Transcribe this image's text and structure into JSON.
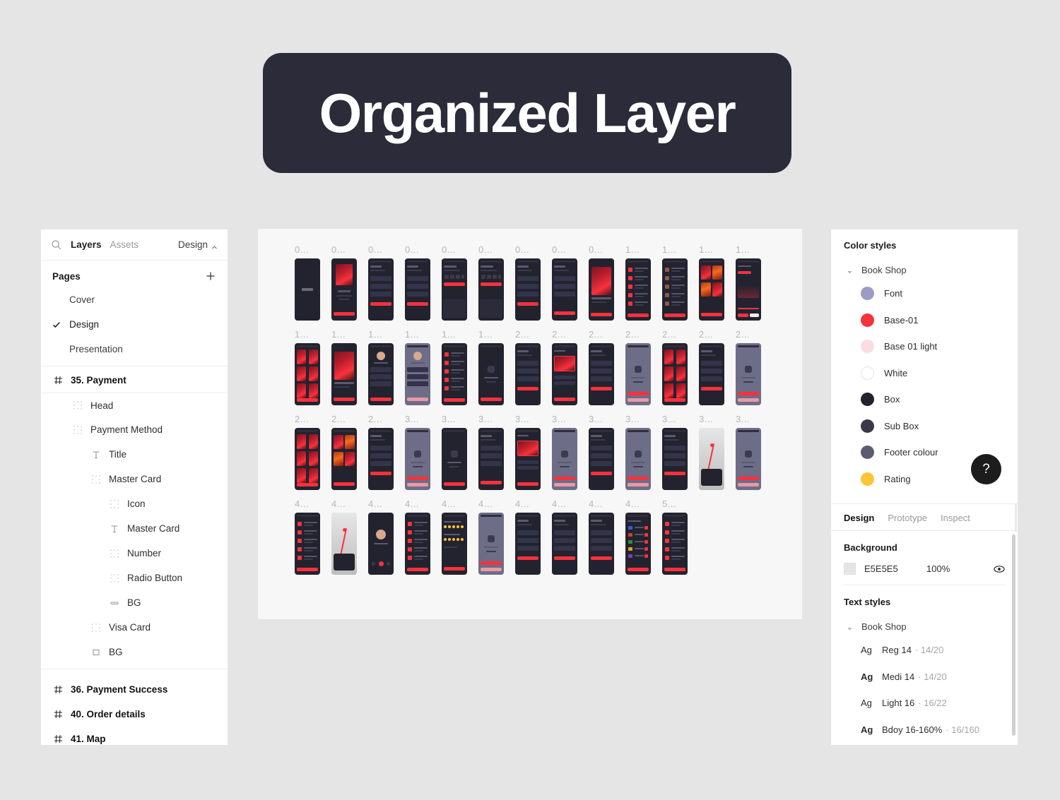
{
  "banner": {
    "title": "Organized Layer"
  },
  "left_panel": {
    "tabs": {
      "layers": "Layers",
      "assets": "Assets",
      "right_mode": "Design"
    },
    "pages": {
      "header": "Pages",
      "items": [
        {
          "label": "Cover",
          "selected": false
        },
        {
          "label": "Design",
          "selected": true
        },
        {
          "label": "Presentation",
          "selected": false
        }
      ]
    },
    "layers": [
      {
        "label": "35. Payment",
        "icon": "frame-icon",
        "depth": 0,
        "type": "frame"
      },
      {
        "label": "Head",
        "icon": "component-icon",
        "depth": 1,
        "type": "group"
      },
      {
        "label": "Payment Method",
        "icon": "component-icon",
        "depth": 1,
        "type": "group"
      },
      {
        "label": "Title",
        "icon": "text-icon",
        "depth": 2,
        "type": "text"
      },
      {
        "label": "Master Card",
        "icon": "component-icon",
        "depth": 2,
        "type": "group"
      },
      {
        "label": "Icon",
        "icon": "component-icon",
        "depth": 3,
        "type": "group"
      },
      {
        "label": "Master Card",
        "icon": "text-icon",
        "depth": 3,
        "type": "text"
      },
      {
        "label": "Number",
        "icon": "component-icon",
        "depth": 3,
        "type": "group"
      },
      {
        "label": "Radio Button",
        "icon": "component-icon",
        "depth": 3,
        "type": "group"
      },
      {
        "label": "BG",
        "icon": "rounded-rect-icon",
        "depth": 3,
        "type": "shape"
      },
      {
        "label": "Visa Card",
        "icon": "component-icon",
        "depth": 2,
        "type": "group"
      },
      {
        "label": "BG",
        "icon": "rect-icon",
        "depth": 2,
        "type": "shape"
      },
      {
        "label": "36. Payment Success",
        "icon": "frame-icon",
        "depth": 0,
        "type": "frame"
      },
      {
        "label": "40. Order details",
        "icon": "frame-icon",
        "depth": 0,
        "type": "frame"
      },
      {
        "label": "41. Map",
        "icon": "frame-icon",
        "depth": 0,
        "type": "frame"
      }
    ]
  },
  "right_panel": {
    "color_styles": {
      "title": "Color styles",
      "group": "Book Shop",
      "items": [
        {
          "label": "Font",
          "color": "#9b9bc4"
        },
        {
          "label": "Base-01",
          "color": "#f8323c"
        },
        {
          "label": "Base 01 light",
          "color": "#fadde1"
        },
        {
          "label": "White",
          "color": "#ffffff"
        },
        {
          "label": "Box",
          "color": "#23232f"
        },
        {
          "label": "Sub Box",
          "color": "#393949"
        },
        {
          "label": "Footer colour",
          "color": "#5c5c70"
        },
        {
          "label": "Rating",
          "color": "#fdc435"
        }
      ]
    },
    "mode_tabs": [
      {
        "label": "Design",
        "active": true
      },
      {
        "label": "Prototype",
        "active": false
      },
      {
        "label": "Inspect",
        "active": false
      }
    ],
    "background": {
      "title": "Background",
      "hex": "E5E5E5",
      "opacity": "100%",
      "visibility_icon": "eye-icon"
    },
    "text_styles": {
      "title": "Text styles",
      "group": "Book Shop",
      "items": [
        {
          "preview": "Ag",
          "weight": "regular",
          "name": "Reg 14",
          "meta": "· 14/20"
        },
        {
          "preview": "Ag",
          "weight": "bold",
          "name": "Medi 14",
          "meta": "· 14/20"
        },
        {
          "preview": "Ag",
          "weight": "light",
          "name": "Light 16",
          "meta": "· 16/22"
        },
        {
          "preview": "Ag",
          "weight": "bold",
          "name": "Bdoy 16-160%",
          "meta": "· 16/160"
        }
      ]
    },
    "help_button": "?"
  },
  "canvas": {
    "rows": [
      {
        "labels": [
          "0...",
          "0...",
          "0...",
          "0...",
          "0...",
          "0...",
          "0...",
          "0...",
          "0...",
          "1...",
          "1...",
          "1...",
          "1..."
        ]
      },
      {
        "labels": [
          "1...",
          "1...",
          "1...",
          "1...",
          "1...",
          "1...",
          "2...",
          "2...",
          "2...",
          "2...",
          "2...",
          "2...",
          "2..."
        ]
      },
      {
        "labels": [
          "2...",
          "2...",
          "2...",
          "3...",
          "3...",
          "3...",
          "3...",
          "3...",
          "3...",
          "3...",
          "3...",
          "3...",
          "3..."
        ]
      },
      {
        "labels": [
          "4...",
          "4...",
          "4...",
          "4...",
          "4...",
          "4...",
          "4...",
          "4...",
          "4...",
          "4...",
          "5..."
        ]
      }
    ]
  }
}
